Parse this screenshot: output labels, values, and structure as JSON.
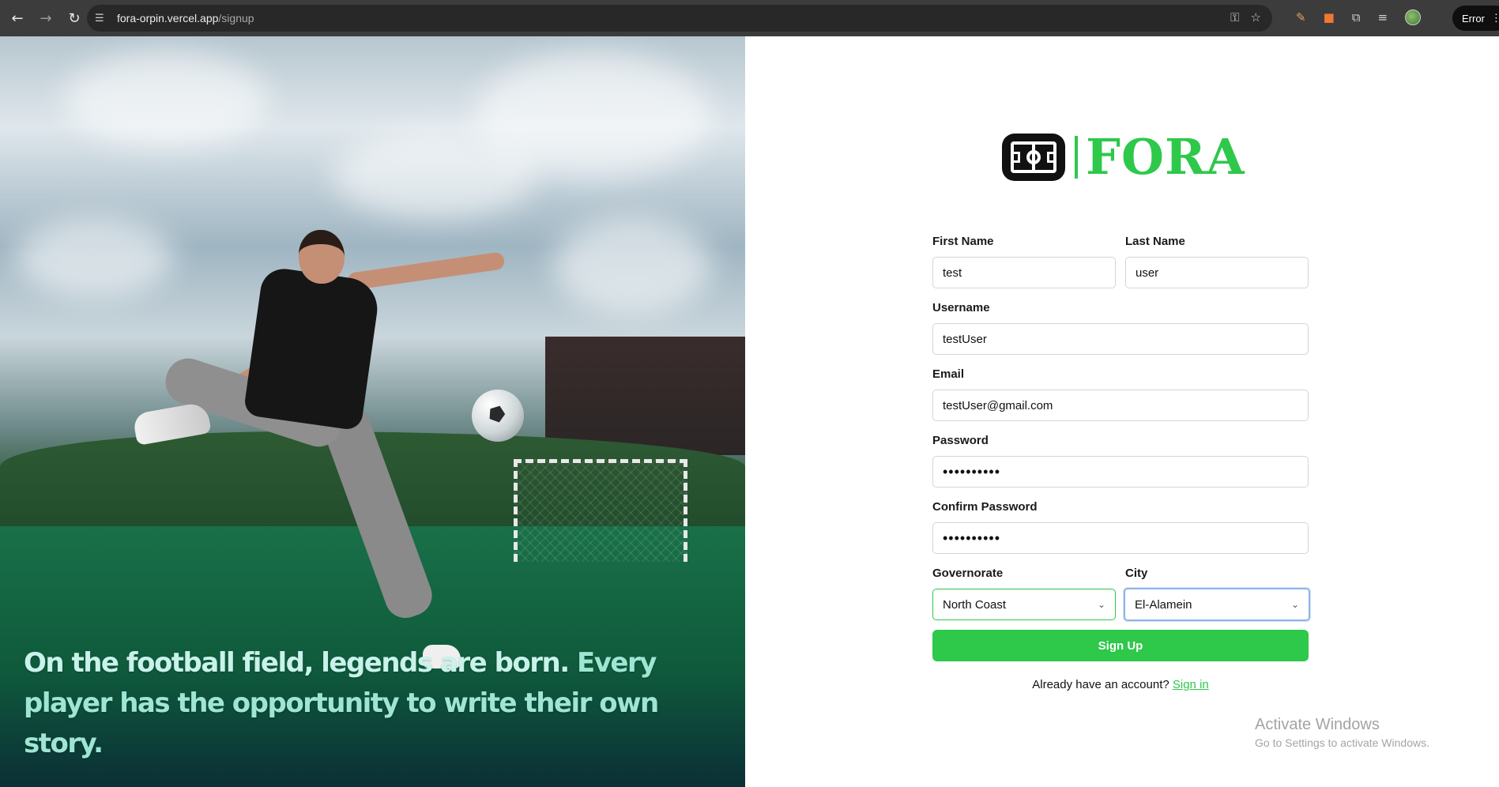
{
  "browser": {
    "url_host": "fora-orpin.vercel.app",
    "url_path": "/signup",
    "error_label": "Error"
  },
  "hero": {
    "quote_lead": "On the football field, legends are born.",
    "quote_rest": " Every player has the opportunity to write their own story."
  },
  "brand": {
    "name": "FORA",
    "accent_color": "#2ec84b"
  },
  "form": {
    "first_name": {
      "label": "First Name",
      "value": "test"
    },
    "last_name": {
      "label": "Last Name",
      "value": "user"
    },
    "username": {
      "label": "Username",
      "value": "testUser"
    },
    "email": {
      "label": "Email",
      "value": "testUser@gmail.com"
    },
    "password": {
      "label": "Password",
      "value": "••••••••••"
    },
    "confirm_password": {
      "label": "Confirm Password",
      "value": "••••••••••"
    },
    "governorate": {
      "label": "Governorate",
      "value": "North Coast"
    },
    "city": {
      "label": "City",
      "value": "El-Alamein"
    },
    "submit_label": "Sign Up",
    "signin_prompt": "Already have an account?",
    "signin_link": "Sign in"
  },
  "watermark": {
    "title": "Activate Windows",
    "subtitle": "Go to Settings to activate Windows."
  },
  "icons": {
    "back": "arrow-left-icon",
    "forward": "arrow-right-icon",
    "reload": "reload-icon",
    "site_settings": "tune-icon",
    "password_key": "key-icon",
    "bookmark": "star-icon",
    "extensions": "puzzle-icon",
    "chevron": "chevron-down-icon"
  }
}
